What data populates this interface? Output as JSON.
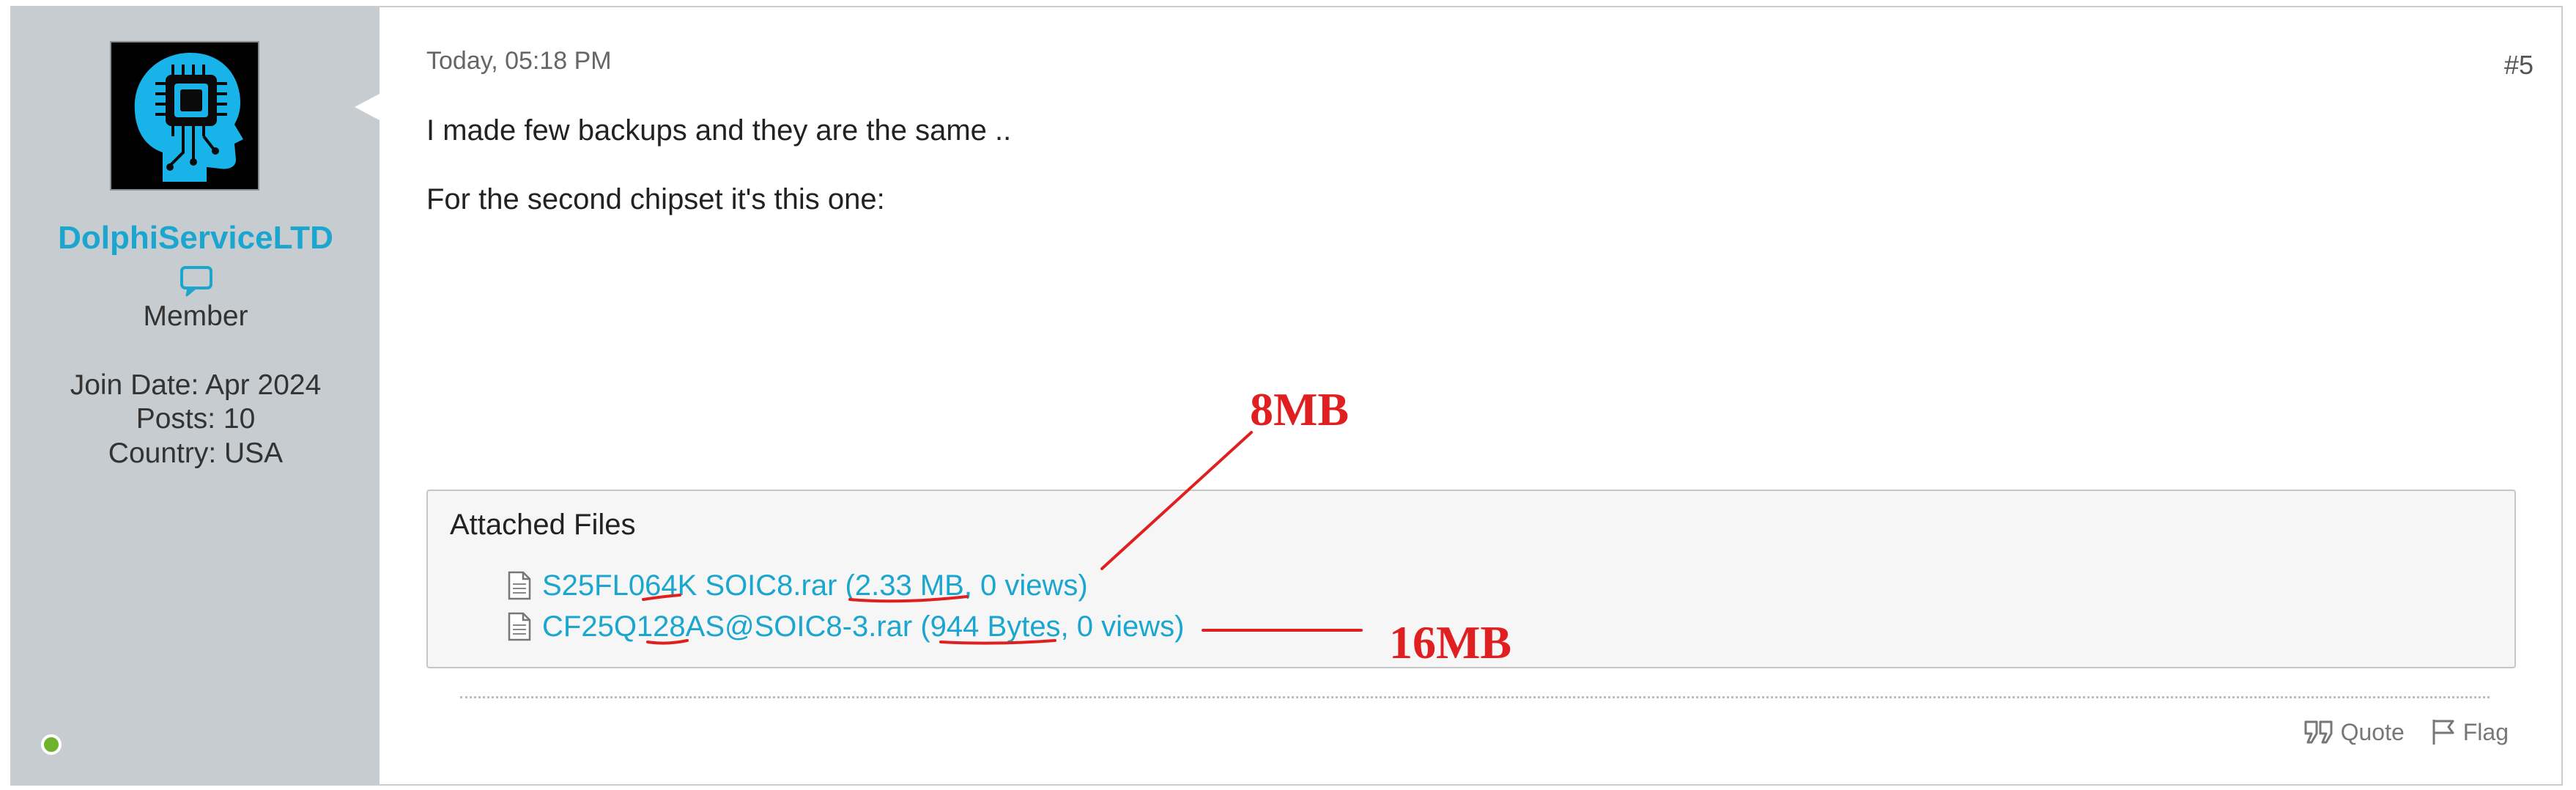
{
  "post": {
    "date": "Today, 05:18 PM",
    "number": "#5",
    "message_line1": "I made few backups and they are the same ..",
    "message_line2": "For the second chipset it's this one:"
  },
  "author": {
    "username": "DolphiServiceLTD",
    "role": "Member",
    "join_date": "Join Date: Apr 2024",
    "posts": "Posts: 10",
    "country": "Country: USA",
    "status_color": "#6fb32c",
    "avatar_icon": "head-chip-icon"
  },
  "attachments": {
    "title": "Attached Files",
    "files": [
      {
        "label": "S25FL064K SOIC8.rar (2.33 MB, 0 views)",
        "icon": "file-icon"
      },
      {
        "label": "CF25Q128AS@SOIC8-3.rar (944 Bytes, 0 views)",
        "icon": "file-icon"
      }
    ]
  },
  "actions": {
    "quote_label": "Quote",
    "flag_label": "Flag"
  },
  "annotations": {
    "label_8mb": "8MB",
    "label_16mb": "16MB",
    "color": "#e02020"
  },
  "colors": {
    "accent": "#1aa6cf",
    "sidebar_bg": "#c7ccd0"
  }
}
